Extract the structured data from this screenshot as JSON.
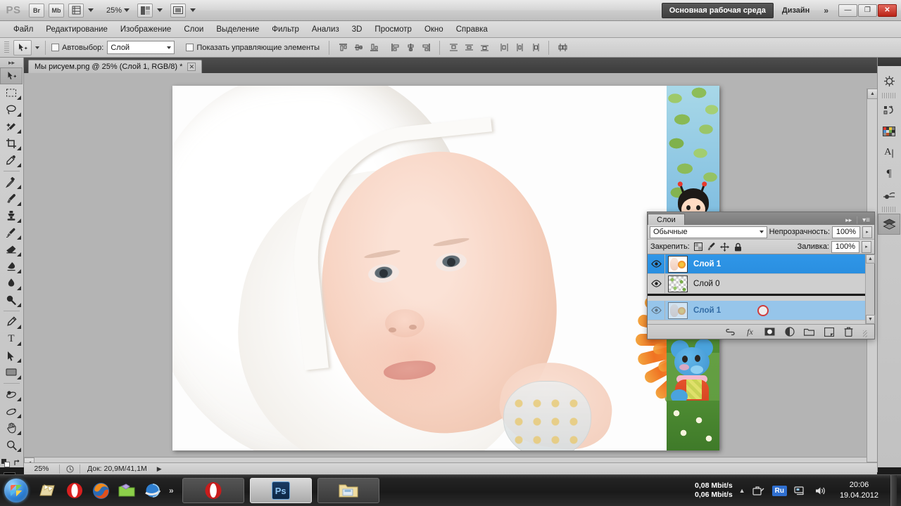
{
  "app": {
    "logo": "PS",
    "zoom_level": "25%",
    "buttons": [
      {
        "name": "bridge-button",
        "label": "Br"
      },
      {
        "name": "mini-bridge-button",
        "label": "Mb"
      },
      {
        "name": "view-extras-button",
        "label": "grid-icon"
      },
      {
        "name": "arrange-documents-button",
        "label": "layout-icon"
      },
      {
        "name": "screen-mode-button",
        "label": "screen-icon"
      }
    ],
    "workspace_active": "Основная рабочая среда",
    "workspace_other": "Дизайн",
    "workspace_overflow": "»",
    "window_buttons": {
      "minimize": "—",
      "restore": "❐",
      "close": "✕"
    }
  },
  "menu": {
    "items": [
      "Файл",
      "Редактирование",
      "Изображение",
      "Слои",
      "Выделение",
      "Фильтр",
      "Анализ",
      "3D",
      "Просмотр",
      "Окно",
      "Справка"
    ]
  },
  "options_bar": {
    "tool_icon": "move-tool-icon",
    "autoselect_label": "Автовыбор:",
    "autoselect_checked": false,
    "autoselect_value": "Слой",
    "show_controls_label": "Показать управляющие элементы",
    "show_controls_checked": false,
    "align_group_1": [
      "align-top-edges",
      "align-vertical-centers",
      "align-bottom-edges"
    ],
    "align_group_2": [
      "align-left-edges",
      "align-horizontal-centers",
      "align-right-edges"
    ],
    "distribute_group_1": [
      "distribute-top-edges",
      "distribute-vertical-centers",
      "distribute-bottom-edges"
    ],
    "distribute_group_2": [
      "distribute-left-edges",
      "distribute-horizontal-centers",
      "distribute-right-edges"
    ],
    "auto_align_label": "auto-align-layers"
  },
  "toolbox": {
    "tools": [
      {
        "name": "move-tool",
        "selected": true,
        "flyout": false
      },
      {
        "name": "rectangular-marquee-tool",
        "selected": false,
        "flyout": true
      },
      {
        "name": "lasso-tool",
        "selected": false,
        "flyout": true
      },
      {
        "name": "quick-selection-tool",
        "selected": false,
        "flyout": true
      },
      {
        "name": "crop-tool",
        "selected": false,
        "flyout": true
      },
      {
        "name": "eyedropper-tool",
        "selected": false,
        "flyout": true
      },
      {
        "name": "spot-healing-brush-tool",
        "selected": false,
        "flyout": true
      },
      {
        "name": "brush-tool",
        "selected": false,
        "flyout": true
      },
      {
        "name": "clone-stamp-tool",
        "selected": false,
        "flyout": true
      },
      {
        "name": "history-brush-tool",
        "selected": false,
        "flyout": true
      },
      {
        "name": "eraser-tool",
        "selected": false,
        "flyout": true
      },
      {
        "name": "gradient-tool",
        "selected": false,
        "flyout": true
      },
      {
        "name": "blur-tool",
        "selected": false,
        "flyout": true
      },
      {
        "name": "dodge-tool",
        "selected": false,
        "flyout": true
      },
      {
        "name": "pen-tool",
        "selected": false,
        "flyout": true
      },
      {
        "name": "horizontal-type-tool",
        "selected": false,
        "flyout": true
      },
      {
        "name": "path-selection-tool",
        "selected": false,
        "flyout": true
      },
      {
        "name": "rectangle-tool",
        "selected": false,
        "flyout": true
      },
      {
        "name": "3d-object-rotate-tool",
        "selected": false,
        "flyout": true
      },
      {
        "name": "3d-camera-rotate-tool",
        "selected": false,
        "flyout": true
      },
      {
        "name": "hand-tool",
        "selected": false,
        "flyout": true
      },
      {
        "name": "zoom-tool",
        "selected": false,
        "flyout": true
      }
    ],
    "foreground_color": "#000000",
    "background_color": "#ffffff",
    "quick_mask": "quick-mask-mode"
  },
  "document": {
    "tab_title": "Мы рисуем.png @ 25% (Слой 1, RGB/8) *",
    "close_glyph": "✕"
  },
  "status_bar": {
    "zoom": "25%",
    "doc_label": "Док: 20,9M/41,1M",
    "arrow": "▶"
  },
  "right_dock": {
    "icons": [
      {
        "name": "mini-bridge-panel-icon",
        "selected": false
      },
      {
        "name": "history-panel-icon",
        "selected": false
      },
      {
        "name": "color-swatches-panel-icon",
        "selected": false
      },
      {
        "name": "character-panel-icon",
        "selected": false
      },
      {
        "name": "paragraph-panel-icon",
        "selected": false
      },
      {
        "name": "adjustments-panel-icon",
        "selected": false
      },
      {
        "name": "layers-panel-icon",
        "selected": true
      }
    ]
  },
  "layers_panel": {
    "tab_title": "Слои",
    "collapse_glyph": "▸▸",
    "menu_glyph": "▾≡",
    "blend_mode": "Обычные",
    "opacity_label": "Непрозрачность:",
    "opacity_value": "100%",
    "lock_label": "Закрепить:",
    "lock_icons": [
      "lock-transparent-pixels-icon",
      "lock-image-pixels-icon",
      "lock-position-icon",
      "lock-all-icon"
    ],
    "fill_label": "Заливка:",
    "fill_value": "100%",
    "rows": [
      {
        "name": "Слой 1",
        "selected": true,
        "visible": true,
        "thumb": "photo"
      },
      {
        "name": "Слой 0",
        "selected": false,
        "visible": true,
        "thumb": "checker"
      }
    ],
    "drag_ghost": {
      "name": "Слой 1",
      "visible": true,
      "thumb": "photo",
      "cursor": "no-drop-circle"
    },
    "footer_buttons": [
      {
        "name": "link-layers-button",
        "glyph": "link"
      },
      {
        "name": "layer-style-button",
        "glyph": "fx"
      },
      {
        "name": "layer-mask-button",
        "glyph": "mask"
      },
      {
        "name": "new-fill-adjustment-layer-button",
        "glyph": "halfcircle"
      },
      {
        "name": "new-group-button",
        "glyph": "folder"
      },
      {
        "name": "new-layer-button",
        "glyph": "newlayer"
      },
      {
        "name": "delete-layer-button",
        "glyph": "trash"
      }
    ]
  },
  "canvas": {
    "artwork_description": "Фотография младенца в белом полотенце с оранжевой герберой",
    "right_strip_description": "Детская иллюстрация: листья, девочка-божья коровка, синий мышонок, ромашки"
  },
  "taskbar": {
    "start_name": "start-orb",
    "quick_launch": [
      {
        "name": "notepad-folder-icon"
      },
      {
        "name": "opera-icon"
      },
      {
        "name": "firefox-icon"
      },
      {
        "name": "green-folder-icon"
      },
      {
        "name": "internet-explorer-icon"
      }
    ],
    "overflow_glyph": "»",
    "windows": [
      {
        "name": "taskbar-window-opera",
        "icon": "opera-icon",
        "active": false
      },
      {
        "name": "taskbar-window-photoshop",
        "icon": "ps-icon",
        "label": "Ps",
        "active": true
      },
      {
        "name": "taskbar-window-explorer",
        "icon": "explorer-icon",
        "active": false
      }
    ],
    "tray": {
      "net_down": "0,08 Mbit/s",
      "net_up": "0,06 Mbit/s",
      "overflow_glyph": "▲",
      "icons": [
        "safely-remove-hardware-icon",
        "network-icon",
        "volume-icon"
      ],
      "language": "Ru",
      "time": "20:06",
      "date": "19.04.2012"
    }
  },
  "colors": {
    "accent_blue": "#2f96e8",
    "ghost_blue": "#8fc4ee",
    "close_red": "#b92316",
    "panel_gray": "#d0d0d0"
  }
}
